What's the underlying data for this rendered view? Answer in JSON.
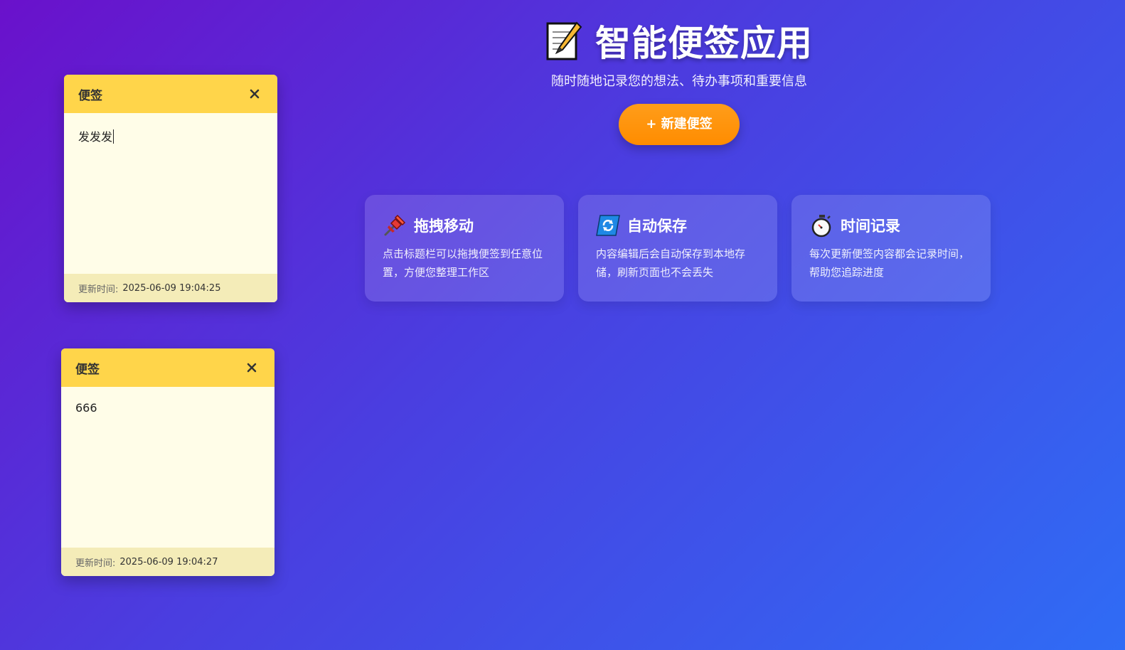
{
  "app": {
    "title": "智能便签应用",
    "subtitle": "随时随地记录您的想法、待办事项和重要信息",
    "new_note_label": "+ 新建便签",
    "title_icon": "memo-icon"
  },
  "features": [
    {
      "icon": "pushpin-icon",
      "title": "拖拽移动",
      "desc": "点击标题栏可以拖拽便签到任意位置，方便您整理工作区"
    },
    {
      "icon": "refresh-icon",
      "title": "自动保存",
      "desc": "内容编辑后会自动保存到本地存储，刷新页面也不会丢失"
    },
    {
      "icon": "stopwatch-icon",
      "title": "时间记录",
      "desc": "每次更新便签内容都会记录时间，帮助您追踪进度"
    }
  ],
  "notes": [
    {
      "title": "便签",
      "content": "发发发",
      "updated_label": "更新时间:",
      "updated_time": "2025-06-09 19:04:25"
    },
    {
      "title": "便签",
      "content": "666",
      "updated_label": "更新时间:",
      "updated_time": "2025-06-09 19:04:27"
    }
  ],
  "colors": {
    "accent_orange": "#ff8c00",
    "note_header": "#ffd54a",
    "note_body": "#fffde8",
    "note_footer": "#f4ecb8"
  }
}
